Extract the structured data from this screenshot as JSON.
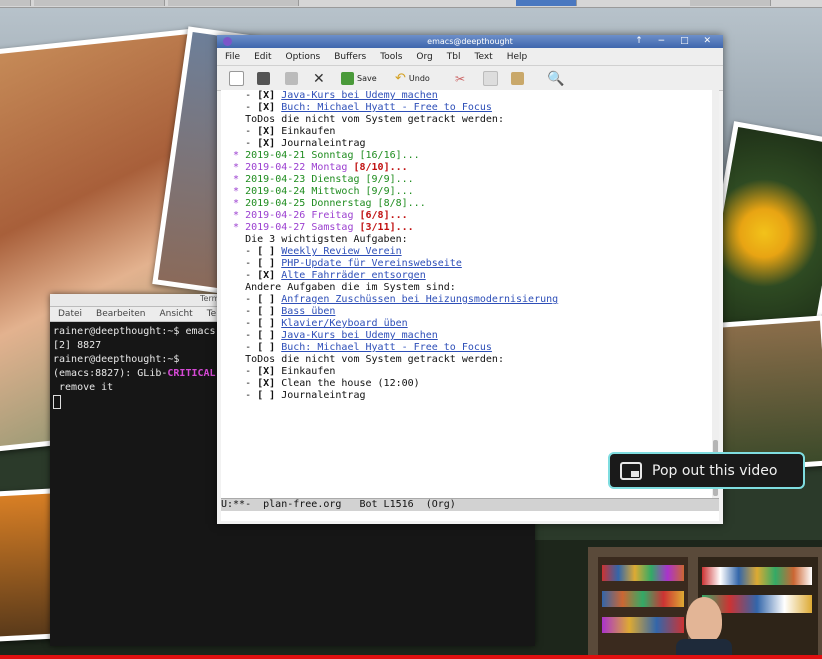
{
  "topbar": {
    "label": ""
  },
  "terminal": {
    "title": "Termi",
    "menu": [
      "Datei",
      "Bearbeiten",
      "Ansicht",
      "Terminal"
    ],
    "lines": [
      "rainer@deepthought:~$ emacs",
      "[2] 8827",
      "rainer@deepthought:~$"
    ],
    "glib_prefix": "(emacs:8827): GLib-",
    "glib_critical": "CRITICAL",
    "remove_line": " remove it"
  },
  "emacs": {
    "title": "emacs@deepthought",
    "window_controls": "↑ − □ ✕",
    "menu": [
      "File",
      "Edit",
      "Options",
      "Buffers",
      "Tools",
      "Org",
      "Tbl",
      "Text",
      "Help"
    ],
    "toolbar": {
      "save": "Save",
      "undo": "Undo"
    },
    "modeline": "U:**-  plan-free.org   Bot L1516  (Org)",
    "modeline_file": "plan-free.org",
    "buffer": {
      "l1_prefix": "    - ",
      "l1_box": "[X]",
      "l1_link": "Java-Kurs bei Udemy machen",
      "l2_prefix": "    - ",
      "l2_box": "[X]",
      "l2_link": "Buch: Michael Hyatt - Free to Focus",
      "l3": "    ToDos die nicht vom System getrackt werden:",
      "l4_prefix": "    - ",
      "l4_box": "[X]",
      "l4_text": " Einkaufen",
      "l5_prefix": "    - ",
      "l5_box": "[X]",
      "l5_text": " Journaleintrag",
      "days": [
        {
          "date": "2019-04-21 Sonntag",
          "count": "[16/16]",
          "done": true
        },
        {
          "date": "2019-04-22 Montag",
          "count": "[8/10]",
          "done": false
        },
        {
          "date": "2019-04-23 Dienstag",
          "count": "[9/9]",
          "done": true
        },
        {
          "date": "2019-04-24 Mittwoch",
          "count": "[9/9]",
          "done": true
        },
        {
          "date": "2019-04-25 Donnerstag",
          "count": "[8/8]",
          "done": true
        },
        {
          "date": "2019-04-26 Freitag",
          "count": "[6/8]",
          "done": false
        },
        {
          "date": "2019-04-27 Samstag",
          "count": "[3/11]",
          "done": false
        }
      ],
      "ellipsis": "...",
      "top3_heading": "    Die 3 wichtigsten Aufgaben:",
      "top3": [
        {
          "box": "[ ]",
          "link": "Weekly Review Verein"
        },
        {
          "box": "[ ]",
          "link": "PHP-Update für Vereinswebseite"
        },
        {
          "box": "[X]",
          "link": "Alte Fahrräder entsorgen"
        }
      ],
      "other_heading": "    Andere Aufgaben die im System sind:",
      "other": [
        {
          "box": "[ ]",
          "link": "Anfragen Zuschüssen bei Heizungsmodernisierung"
        },
        {
          "box": "[ ]",
          "link": "Bass üben"
        },
        {
          "box": "[ ]",
          "link": "Klavier/Keyboard üben"
        },
        {
          "box": "[ ]",
          "link": "Java-Kurs bei Udemy machen"
        },
        {
          "box": "[ ]",
          "link": "Buch: Michael Hyatt - Free to Focus"
        }
      ],
      "todos_heading": "    ToDos die nicht vom System getrackt werden:",
      "todos": [
        {
          "box": "[X]",
          "text": " Einkaufen"
        },
        {
          "box": "[X]",
          "text": " Clean the house (12:00)"
        },
        {
          "box": "[ ]",
          "text": " Journaleintrag"
        }
      ]
    }
  },
  "popout": {
    "label": "Pop out this video"
  },
  "colors": {
    "link": "#2e4fb8",
    "done": "#1e8c1e",
    "undone": "#c01010",
    "heading_star": "#9b3fd0",
    "popout_border": "#7fdde0"
  }
}
